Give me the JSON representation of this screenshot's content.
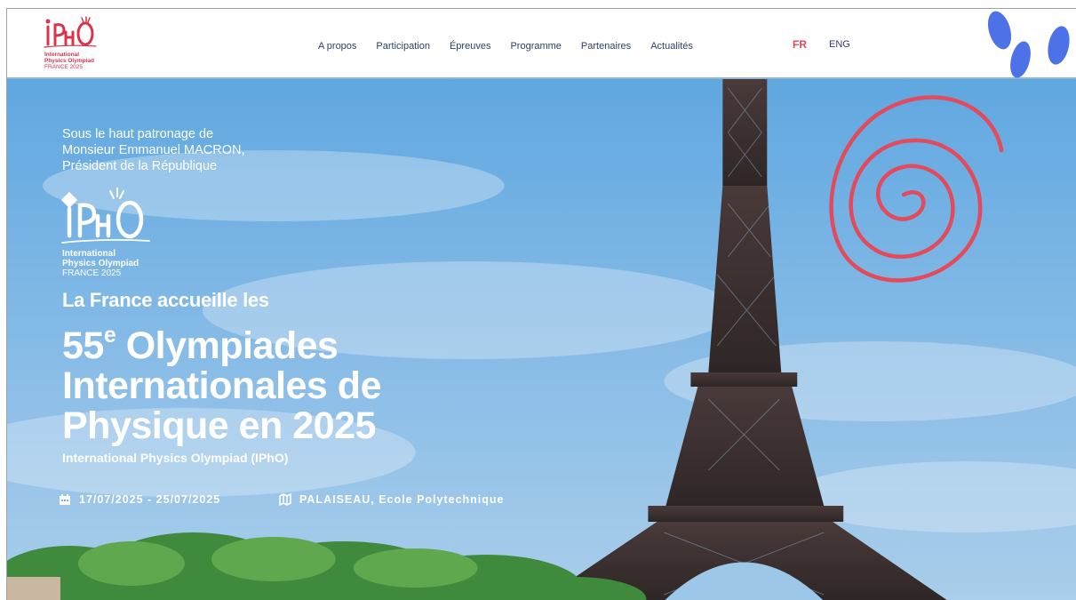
{
  "header": {
    "logo": {
      "mark_text": "IPhO",
      "line1": "International",
      "line2": "Physics Olympiad",
      "line3": "FRANCE 2025"
    },
    "nav": [
      "A propos",
      "Participation",
      "Épreuves",
      "Programme",
      "Partenaires",
      "Actualités"
    ],
    "lang_fr": "FR",
    "lang_en": "ENG"
  },
  "hero": {
    "patronage": [
      "Sous le haut patronage de",
      "Monsieur Emmanuel MACRON,",
      "Président de la République"
    ],
    "logo": {
      "mark_text": "IPhO",
      "line1": "International",
      "line2": "Physics Olympiad",
      "line3": "FRANCE 2025"
    },
    "headline_top": "La France accueille les",
    "headline_number": "55",
    "headline_sup": "e",
    "headline_line1_rest": " Olympiades",
    "headline_line2": "Internationales de",
    "headline_line3": "Physique en 2025",
    "subtitle": "International Physics Olympiad (IPhO)",
    "dates": "17/07/2025 - 25/07/2025",
    "location": "PALAISEAU, Ecole Polytechnique"
  },
  "colors": {
    "accent_red": "#e34a5c",
    "navy": "#2d3e66",
    "blob_blue": "#4d72e8",
    "sky": "#79b6e6"
  },
  "icons": [
    "calendar-icon",
    "map-icon",
    "spiral-decoration",
    "eiffel-tower-image"
  ]
}
